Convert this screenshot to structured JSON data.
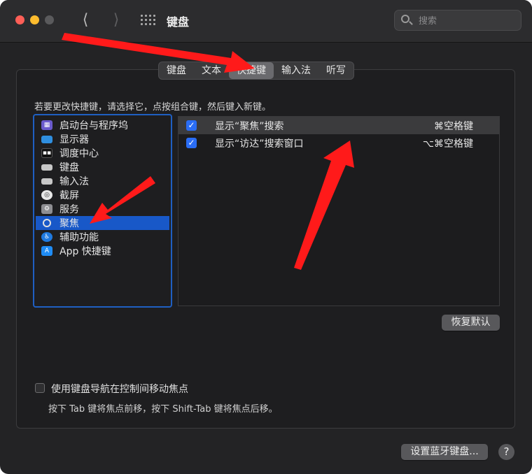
{
  "window": {
    "title": "键盘"
  },
  "search": {
    "placeholder": "搜索"
  },
  "tabs": [
    {
      "label": "键盘",
      "active": false
    },
    {
      "label": "文本",
      "active": false
    },
    {
      "label": "快捷键",
      "active": true
    },
    {
      "label": "输入法",
      "active": false
    },
    {
      "label": "听写",
      "active": false
    }
  ],
  "instruction": "若要更改快捷键，请选择它，点按组合键，然后键入新键。",
  "categories": [
    {
      "label": "启动台与程序坞",
      "icon": "launchpad-icon",
      "selected": false
    },
    {
      "label": "显示器",
      "icon": "display-icon",
      "selected": false
    },
    {
      "label": "调度中心",
      "icon": "mission-control-icon",
      "selected": false
    },
    {
      "label": "键盘",
      "icon": "keyboard-icon",
      "selected": false
    },
    {
      "label": "输入法",
      "icon": "input-method-icon",
      "selected": false
    },
    {
      "label": "截屏",
      "icon": "screenshot-icon",
      "selected": false
    },
    {
      "label": "服务",
      "icon": "services-gear-icon",
      "selected": false
    },
    {
      "label": "聚焦",
      "icon": "spotlight-icon",
      "selected": true
    },
    {
      "label": "辅助功能",
      "icon": "accessibility-icon",
      "selected": false
    },
    {
      "label": "App 快捷键",
      "icon": "app-store-icon",
      "selected": false
    }
  ],
  "shortcuts": [
    {
      "name": "显示“聚焦”搜索",
      "key": "⌘空格键",
      "checked": true
    },
    {
      "name": "显示“访达”搜索窗口",
      "key": "⌥⌘空格键",
      "checked": true
    }
  ],
  "buttons": {
    "restore_defaults": "恢复默认",
    "setup_bluetooth": "设置蓝牙键盘...",
    "help": "?"
  },
  "keyboard_navigation": {
    "label": "使用键盘导航在控制间移动焦点",
    "hint": "按下 Tab 键将焦点前移，按下 Shift-Tab 键将焦点后移。",
    "checked": false
  },
  "colors": {
    "accent": "#1858c8",
    "checkbox": "#2a6df5",
    "annotation_arrow": "#ff1a1a"
  }
}
